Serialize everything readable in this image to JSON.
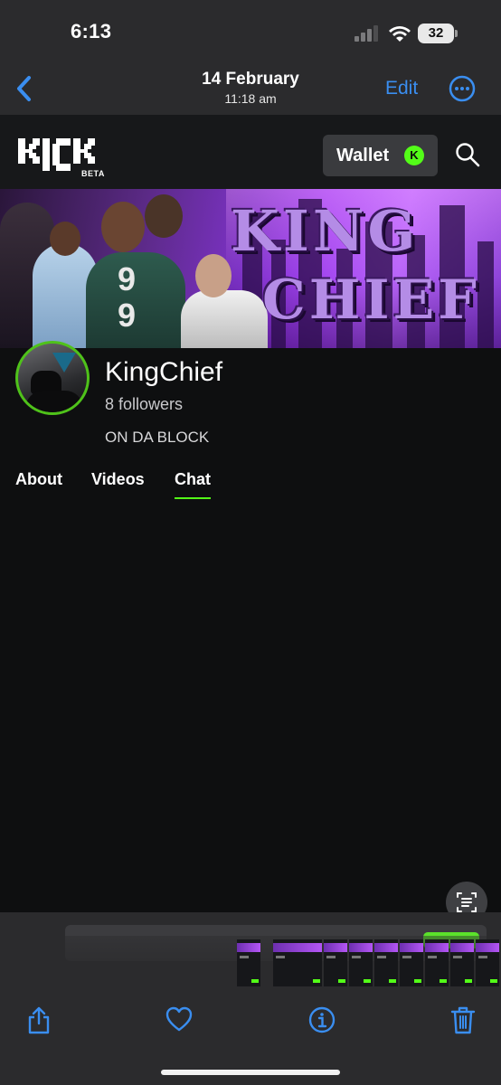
{
  "status_bar": {
    "time": "6:13",
    "battery": "32"
  },
  "nav": {
    "title": "14 February",
    "subtitle": "11:18 am",
    "edit_label": "Edit"
  },
  "kick": {
    "logo_text": "KICK",
    "beta_label": "BETA",
    "wallet_label": "Wallet",
    "wallet_coin": "K",
    "banner_text_line1": "KING",
    "banner_text_line2": "CHIEF",
    "channel_name": "KingChief",
    "followers": "8 followers",
    "bio": "ON DA BLOCK",
    "tabs": [
      {
        "label": "About",
        "active": false
      },
      {
        "label": "Videos",
        "active": false
      },
      {
        "label": "Chat",
        "active": true
      }
    ],
    "accent_color": "#53fc18"
  },
  "toolbar": {
    "icons": [
      "share-icon",
      "heart-icon",
      "info-icon",
      "trash-icon"
    ]
  }
}
